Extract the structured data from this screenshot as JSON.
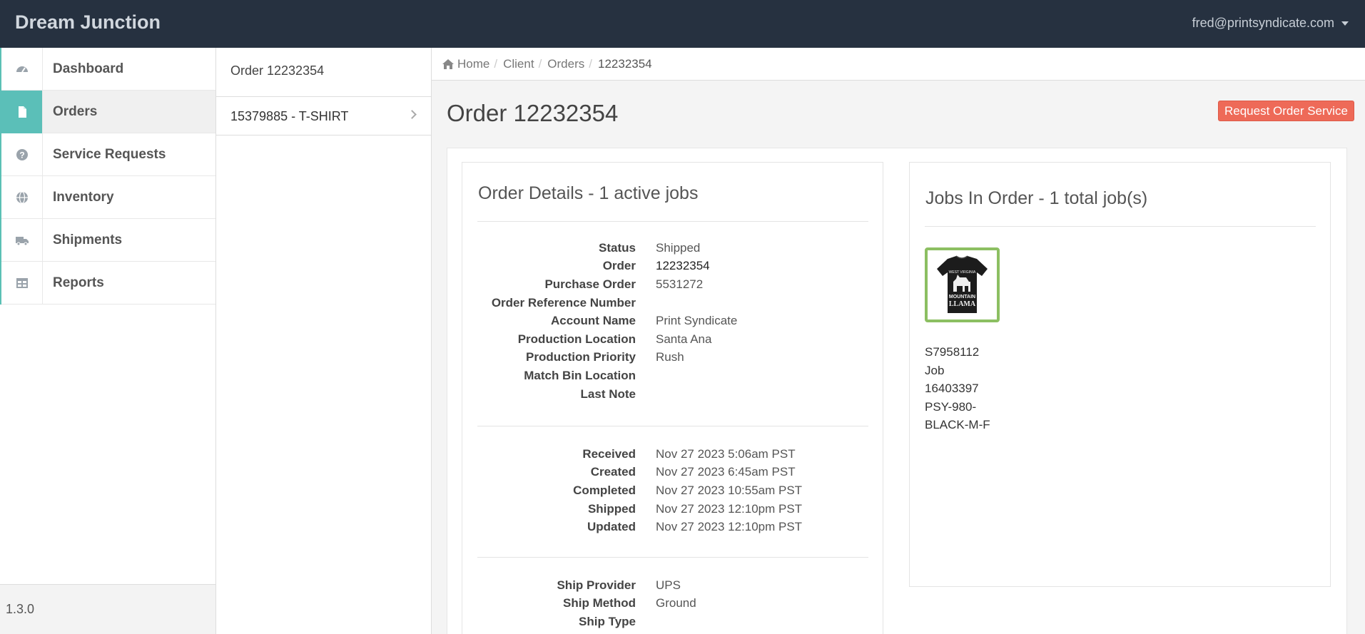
{
  "header": {
    "brand": "Dream Junction",
    "user_email": "fred@printsyndicate.com"
  },
  "sidebar": {
    "items": [
      {
        "label": "Dashboard",
        "icon": "dashboard-icon"
      },
      {
        "label": "Orders",
        "icon": "file-icon",
        "active": true
      },
      {
        "label": "Service Requests",
        "icon": "question-icon"
      },
      {
        "label": "Inventory",
        "icon": "globe-icon"
      },
      {
        "label": "Shipments",
        "icon": "truck-icon"
      },
      {
        "label": "Reports",
        "icon": "table-icon"
      }
    ],
    "version": "1.3.0"
  },
  "subnav": {
    "title": "Order 12232354",
    "items": [
      {
        "label": "15379885 - T-SHIRT"
      }
    ]
  },
  "breadcrumb": {
    "home": "Home",
    "client": "Client",
    "orders": "Orders",
    "current": "12232354"
  },
  "page": {
    "title": "Order 12232354",
    "request_button": "Request Order Service"
  },
  "order_details": {
    "title": "Order Details - 1 active jobs",
    "fields": [
      {
        "label": "Status",
        "value": "Shipped"
      },
      {
        "label": "Order",
        "value": "12232354"
      },
      {
        "label": "Purchase Order",
        "value": "5531272"
      },
      {
        "label": "Order Reference Number",
        "value": ""
      },
      {
        "label": "Account Name",
        "value": "Print Syndicate"
      },
      {
        "label": "Production Location",
        "value": "Santa Ana"
      },
      {
        "label": "Production Priority",
        "value": "Rush"
      },
      {
        "label": "Match Bin Location",
        "value": ""
      },
      {
        "label": "Last Note",
        "value": ""
      }
    ],
    "dates": [
      {
        "label": "Received",
        "value": "Nov 27 2023 5:06am PST"
      },
      {
        "label": "Created",
        "value": "Nov 27 2023 6:45am PST"
      },
      {
        "label": "Completed",
        "value": "Nov 27 2023 10:55am PST"
      },
      {
        "label": "Shipped",
        "value": "Nov 27 2023 12:10pm PST"
      },
      {
        "label": "Updated",
        "value": "Nov 27 2023 12:10pm PST"
      }
    ],
    "shipping": [
      {
        "label": "Ship Provider",
        "value": "UPS"
      },
      {
        "label": "Ship Method",
        "value": "Ground"
      },
      {
        "label": "Ship Type",
        "value": ""
      }
    ]
  },
  "jobs": {
    "title": "Jobs In Order - 1 total job(s)",
    "items": [
      {
        "lines": [
          "S7958112",
          "Job",
          "16403397",
          "PSY-980-",
          "BLACK-M-F"
        ],
        "thumb_text": {
          "top": "WEST VIRGINIA",
          "mid": "MOUNTAIN",
          "bottom": "LLAMA"
        }
      }
    ]
  }
}
